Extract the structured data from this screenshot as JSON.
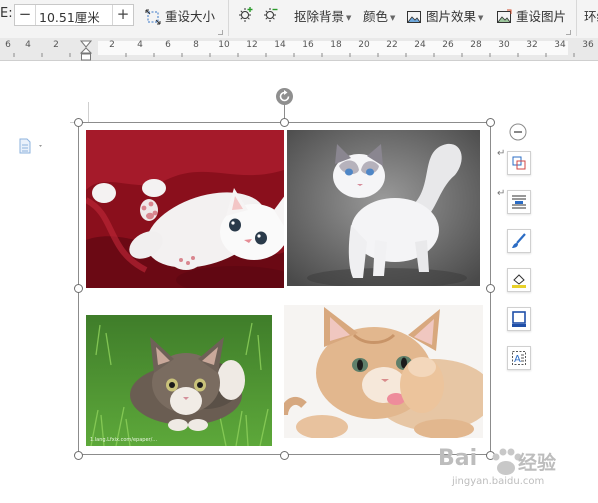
{
  "toolbar": {
    "size_label_fragment": "E:",
    "width_field": {
      "value": "10.51厘米",
      "decrement": "−",
      "increment": "+"
    },
    "reset_size_label": "重设大小",
    "remove_background_label": "抠除背景",
    "color_label": "颜色",
    "picture_effects_label": "图片效果",
    "reset_picture_label": "重设图片",
    "wrap_label_fragment": "环绕"
  },
  "ruler": {
    "ticks": [
      "6",
      "4",
      "2",
      "2",
      "4",
      "6",
      "8",
      "10",
      "12",
      "14",
      "16",
      "18",
      "20",
      "22",
      "24",
      "26",
      "28",
      "30",
      "32",
      "34",
      "36"
    ]
  },
  "canvas": {
    "images": [
      "kitten-on-red-blanket",
      "white-ragdoll-cat",
      "kitten-in-grass",
      "ginger-kitten-licking-paw"
    ],
    "image_caption_fragment": "1.lang.Lfxix.com/epaper/..."
  },
  "watermark": {
    "brand": "Bai",
    "brand_cn": "经验",
    "sub": "jingyan.baidu.com"
  },
  "icons": [
    "rotate-icon",
    "collapse-minus-icon",
    "crop-icon",
    "wrap-text-icon",
    "brush-icon",
    "fill-icon",
    "border-icon",
    "text-wrap-icon",
    "document-icon",
    "paw-icon"
  ]
}
